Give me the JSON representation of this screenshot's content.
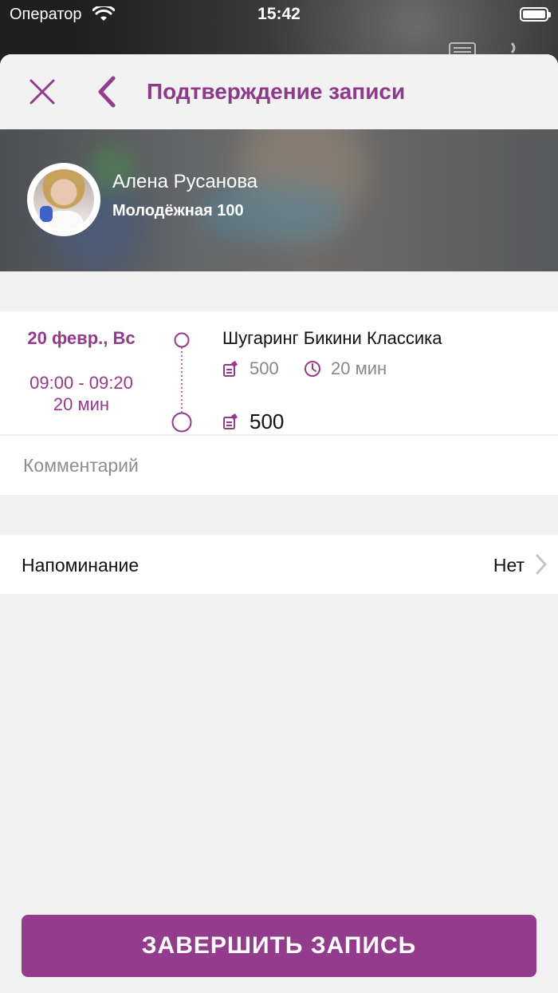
{
  "status_bar": {
    "carrier": "Оператор",
    "time": "15:42"
  },
  "header": {
    "title": "Подтверждение записи"
  },
  "master": {
    "name": "Алена Русанова",
    "address": "Молодёжная 100"
  },
  "booking": {
    "date": "20 февр., Вс",
    "time_range": "09:00 - 09:20",
    "duration": "20 мин",
    "service_name": "Шугаринг Бикини Классика",
    "service_price": "500",
    "service_duration": "20 мин",
    "total": "500"
  },
  "comment": {
    "placeholder": "Комментарий"
  },
  "reminder": {
    "label": "Напоминание",
    "value": "Нет"
  },
  "actions": {
    "finish_label": "ЗАВЕРШИТЬ ЗАПИСЬ"
  },
  "colors": {
    "accent": "#933b8c",
    "title": "#8e3a8a",
    "background": "#f1f1f1"
  },
  "icons": [
    "wifi-icon",
    "battery-icon",
    "close-icon",
    "back-chevron-icon",
    "price-tag-icon",
    "clock-icon",
    "chevron-right-icon"
  ]
}
